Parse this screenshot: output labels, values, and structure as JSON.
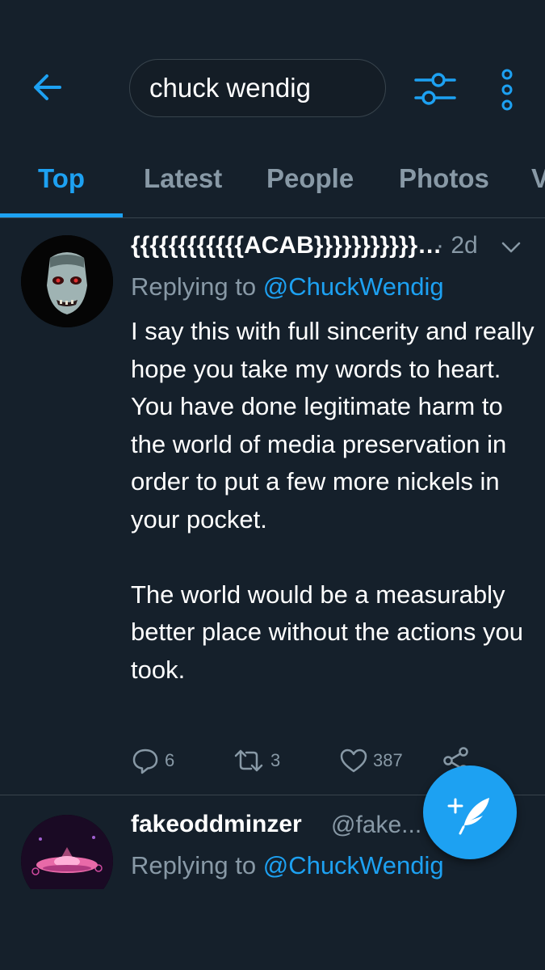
{
  "search": {
    "query": "chuck wendig"
  },
  "tabs": [
    {
      "label": "Top",
      "active": true
    },
    {
      "label": "Latest",
      "active": false
    },
    {
      "label": "People",
      "active": false
    },
    {
      "label": "Photos",
      "active": false
    },
    {
      "label": "Videos",
      "active": false
    }
  ],
  "tweets": [
    {
      "display_name": "{{{{{{{{{{{{ACAB}}}}}}}}}}}…",
      "time": "· 2d",
      "reply_prefix": "Replying to ",
      "reply_to": "@ChuckWendig",
      "text": "I say this with full sincerity and really hope you take my words to heart. You have done legitimate harm to the world of media preservation in order to put a few more nickels in your pocket.\n\nThe world would be a measurably better place without the actions you took.",
      "replies": "6",
      "retweets": "3",
      "likes": "387"
    },
    {
      "display_name": "fakeoddminzer",
      "handle": "@fake...",
      "reply_prefix": "Replying to ",
      "reply_to": "@ChuckWendig"
    }
  ],
  "colors": {
    "background": "#15202b",
    "accent": "#1da1f2",
    "muted": "#8899a6",
    "divider": "#38444d"
  },
  "icons": [
    "back-arrow-icon",
    "filter-icon",
    "more-vertical-icon",
    "chevron-down-icon",
    "reply-icon",
    "retweet-icon",
    "like-icon",
    "share-icon",
    "compose-tweet-icon"
  ]
}
